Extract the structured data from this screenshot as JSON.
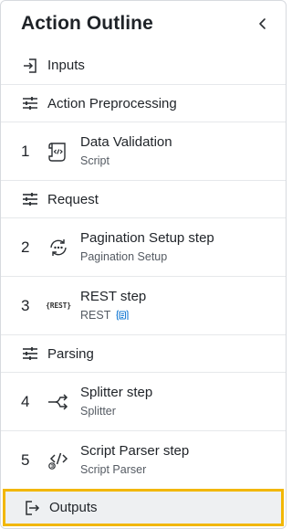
{
  "header": {
    "title": "Action Outline"
  },
  "items": {
    "inputs": {
      "label": "Inputs"
    },
    "preprocessing": {
      "label": "Action Preprocessing"
    },
    "step1": {
      "number": "1",
      "title": "Data Validation",
      "subtitle": "Script"
    },
    "request": {
      "label": "Request"
    },
    "step2": {
      "number": "2",
      "title": "Pagination Setup step",
      "subtitle": "Pagination Setup"
    },
    "step3": {
      "number": "3",
      "title": "REST step",
      "subtitle": "REST",
      "icon_text": "{REST}"
    },
    "parsing": {
      "label": "Parsing"
    },
    "step4": {
      "number": "4",
      "title": "Splitter step",
      "subtitle": "Splitter"
    },
    "step5": {
      "number": "5",
      "title": "Script Parser step",
      "subtitle": "Script Parser"
    },
    "outputs": {
      "label": "Outputs"
    }
  },
  "icons": {
    "collapse": "chevron-left-icon",
    "inputs": "sign-in-icon",
    "section": "sliders-icon",
    "script": "script-scroll-icon",
    "pagination": "pagination-cycle-icon",
    "rest": "rest-braces-icon",
    "swagger": "swagger-icon",
    "splitter": "split-arrow-icon",
    "script_parser": "code-parser-icon",
    "outputs": "sign-out-icon"
  },
  "colors": {
    "highlight_outline": "#f2b705",
    "highlight_bg": "#eef0f2",
    "swagger_blue": "#1e7fd6",
    "divider": "#e6e8eb"
  }
}
